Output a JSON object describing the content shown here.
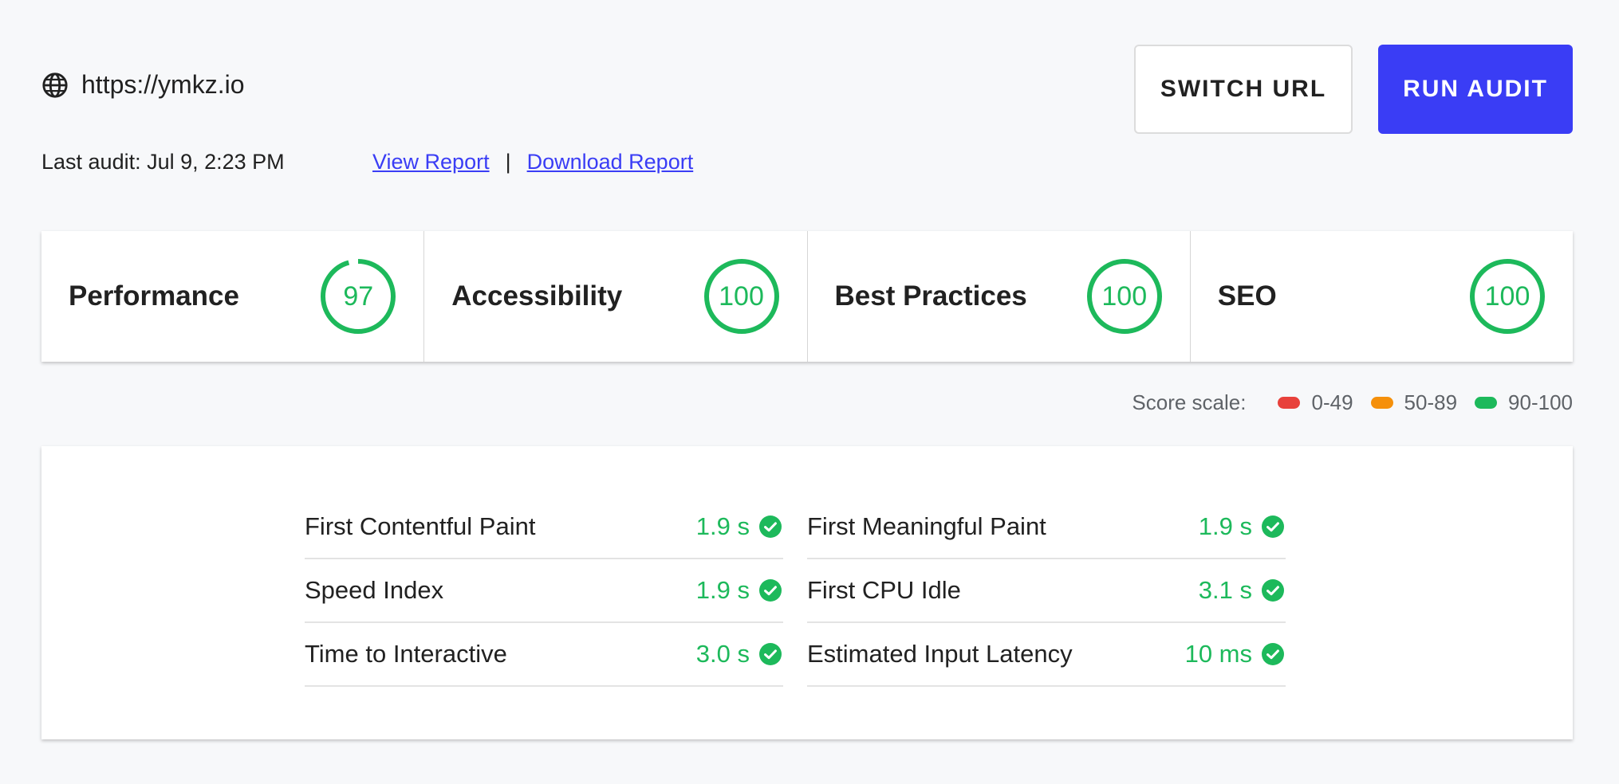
{
  "header": {
    "url": "https://ymkz.io",
    "switch_label": "SWITCH URL",
    "run_label": "RUN AUDIT",
    "last_audit": "Last audit: Jul 9, 2:23 PM",
    "view_report": "View Report",
    "separator": "|",
    "download_report": "Download Report"
  },
  "scores": [
    {
      "title": "Performance",
      "score": 97
    },
    {
      "title": "Accessibility",
      "score": 100
    },
    {
      "title": "Best Practices",
      "score": 100
    },
    {
      "title": "SEO",
      "score": 100
    }
  ],
  "legend": {
    "label": "Score scale:",
    "items": [
      {
        "range": "0-49",
        "color": "#e8413b"
      },
      {
        "range": "50-89",
        "color": "#f5900b"
      },
      {
        "range": "90-100",
        "color": "#1db95b"
      }
    ]
  },
  "metrics": [
    {
      "label": "First Contentful Paint",
      "value": "1.9 s"
    },
    {
      "label": "First Meaningful Paint",
      "value": "1.9 s"
    },
    {
      "label": "Speed Index",
      "value": "1.9 s"
    },
    {
      "label": "First CPU Idle",
      "value": "3.1 s"
    },
    {
      "label": "Time to Interactive",
      "value": "3.0 s"
    },
    {
      "label": "Estimated Input Latency",
      "value": "10 ms"
    }
  ],
  "colors": {
    "accent": "#3a3df5",
    "pass": "#1db95b"
  },
  "icons": {
    "globe": "globe-icon",
    "check": "check-circle-icon"
  }
}
